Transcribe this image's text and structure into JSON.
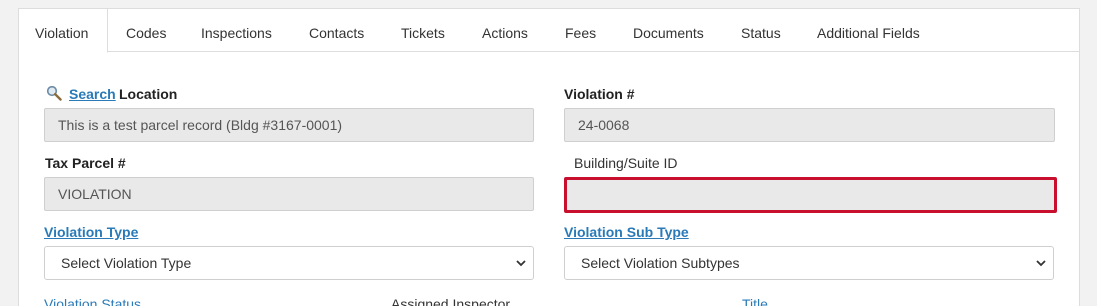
{
  "tabs": [
    {
      "label": "Violation",
      "active": true
    },
    {
      "label": "Codes"
    },
    {
      "label": "Inspections"
    },
    {
      "label": "Contacts"
    },
    {
      "label": "Tickets"
    },
    {
      "label": "Actions"
    },
    {
      "label": "Fees"
    },
    {
      "label": "Documents"
    },
    {
      "label": "Status"
    },
    {
      "label": "Additional Fields"
    }
  ],
  "location": {
    "search_link": "Search",
    "label": "Location",
    "value": "This is a test parcel record (Bldg #3167-0001)",
    "search_icon": "magnifier-icon"
  },
  "violation_number": {
    "label": "Violation #",
    "value": "24-0068"
  },
  "tax_parcel": {
    "label": "Tax Parcel #",
    "value": "VIOLATION"
  },
  "building_suite": {
    "label": "Building/Suite ID",
    "value": "",
    "error_color": "#c8102e"
  },
  "violation_type": {
    "label": "Violation Type",
    "selected": "Select Violation Type"
  },
  "violation_sub_type": {
    "label": "Violation Sub Type",
    "selected": "Select Violation Subtypes"
  },
  "bottom_row": {
    "violation_status": "Violation Status",
    "assigned_inspector": "Assigned Inspector",
    "title": "Title"
  },
  "colors": {
    "link": "#2a7ab8",
    "error_border": "#c8102e",
    "readonly_bg": "#e9e9e9"
  }
}
